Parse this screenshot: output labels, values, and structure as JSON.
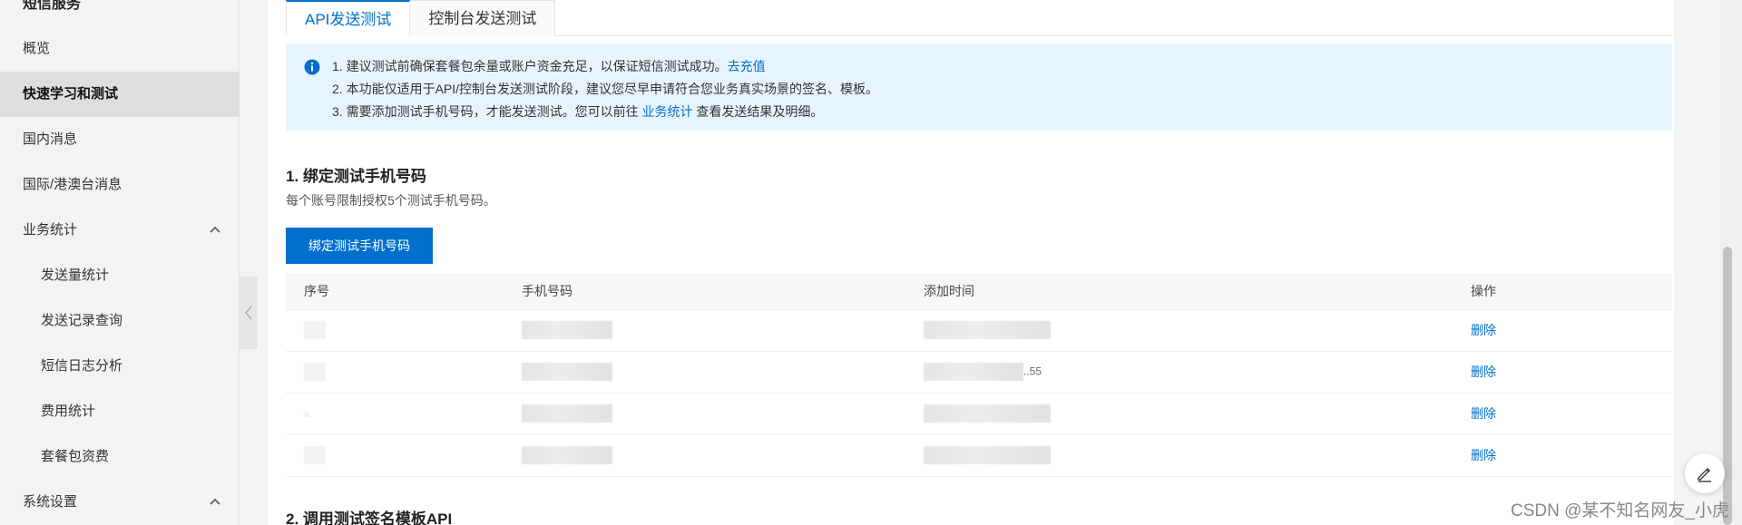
{
  "sidebar": {
    "header": "短信服务",
    "items": [
      {
        "label": "概览"
      },
      {
        "label": "快速学习和测试"
      },
      {
        "label": "国内消息"
      },
      {
        "label": "国际/港澳台消息"
      },
      {
        "label": "业务统计"
      },
      {
        "label": "发送量统计"
      },
      {
        "label": "发送记录查询"
      },
      {
        "label": "短信日志分析"
      },
      {
        "label": "费用统计"
      },
      {
        "label": "套餐包资费"
      },
      {
        "label": "系统设置"
      }
    ]
  },
  "tabs": [
    {
      "label": "API发送测试"
    },
    {
      "label": "控制台发送测试"
    }
  ],
  "notice": {
    "line1": "1. 建议测试前确保套餐包余量或账户资金充足，以保证短信测试成功。",
    "line1_link": "去充值",
    "line2": "2. 本功能仅适用于API/控制台发送测试阶段，建议您尽早申请符合您业务真实场景的签名、模板。",
    "line3_pre": "3. 需要添加测试手机号码，才能发送测试。您可以前往",
    "line3_link": "业务统计",
    "line3_post": "查看发送结果及明细。"
  },
  "section1": {
    "title": "1. 绑定测试手机号码",
    "desc": "每个账号限制授权5个测试手机号码。",
    "button": "绑定测试手机号码"
  },
  "table": {
    "headers": [
      "序号",
      "手机号码",
      "添加时间",
      "操作"
    ],
    "rows": [
      {
        "time_suffix": "",
        "action": "删除"
      },
      {
        "time_suffix": "..55",
        "action": "删除"
      },
      {
        "time_suffix": "",
        "action": "删除"
      },
      {
        "time_suffix": "",
        "action": "删除"
      }
    ]
  },
  "section2": {
    "title": "2. 调用测试签名模板API"
  },
  "watermark": "CSDN @某不知名网友_小虎",
  "colors": {
    "accent": "#0070cc",
    "notice_bg": "#e8f4fd"
  }
}
